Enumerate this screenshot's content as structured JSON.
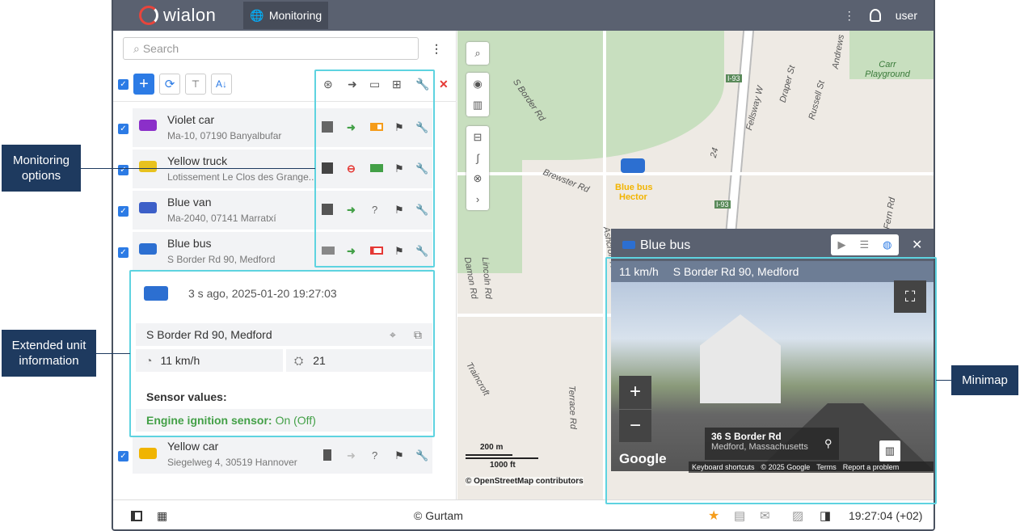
{
  "header": {
    "logo": "wialon",
    "tab_monitoring": "Monitoring",
    "user": "user"
  },
  "search": {
    "placeholder": "Search"
  },
  "units": [
    {
      "name": "Violet car",
      "address": "Ma-10, 07190 Banyalbufar",
      "color": "#8b2fc9"
    },
    {
      "name": "Yellow truck",
      "address": "Lotissement Le Clos des Grange...",
      "color": "#e8c21e"
    },
    {
      "name": "Blue van",
      "address": "Ma-2040, 07141 Marratxí",
      "color": "#3c5fc8"
    },
    {
      "name": "Blue bus",
      "address": "S Border Rd 90, Medford",
      "color": "#2c6fd1"
    },
    {
      "name": "Yellow car",
      "address": "Siegelweg 4, 30519 Hannover",
      "color": "#f0b400"
    }
  ],
  "unit_status": [
    "?",
    "?",
    "?"
  ],
  "extended": {
    "time": "3 s ago, 2025-01-20 19:27:03",
    "address": "S Border Rd 90, Medford",
    "speed": "11 km/h",
    "satellites": "21",
    "sensor_title": "Sensor values:",
    "sensor_name": "Engine ignition sensor:",
    "sensor_value": "On (Off)"
  },
  "map": {
    "bus_label1": "Blue bus",
    "bus_label2": "Hector",
    "attribution": "© OpenStreetMap contributors",
    "scale_m": "200 m",
    "scale_ft": "1000 ft",
    "streets": [
      "S Border Rd",
      "Brewster Rd",
      "Ashcroft Rd",
      "Lincoln Rd",
      "Damon Rd",
      "Traincroft",
      "Terrace Rd",
      "Fellsway W",
      "Draper St",
      "Russell St",
      "Fern Rd",
      "Andrews",
      "I-93",
      "I-93",
      "24",
      "Carr Playground"
    ],
    "plus": "+"
  },
  "minimap": {
    "title": "Blue bus",
    "speed": "11 km/h",
    "address": "S Border Rd 90, Medford",
    "place_name": "36 S Border Rd",
    "place_city": "Medford, Massachusetts",
    "google": "Google",
    "shortcuts": "Keyboard shortcuts",
    "copyright": "© 2025 Google",
    "terms": "Terms",
    "report": "Report a problem",
    "zoom_in": "+",
    "zoom_out": "−"
  },
  "footer": {
    "copyright": "© Gurtam",
    "time": "19:27:04 (+02)"
  },
  "callouts": {
    "monitoring_options": "Monitoring options",
    "extended_info": "Extended unit information",
    "minimap": "Minimap"
  },
  "colors": {
    "topbar": "#5a6170",
    "accent": "#2c7be5",
    "highlight": "#5ed3e0",
    "callout": "#1e3a5f",
    "green": "#43a047",
    "red": "#e53935",
    "orange": "#f59c1a"
  }
}
